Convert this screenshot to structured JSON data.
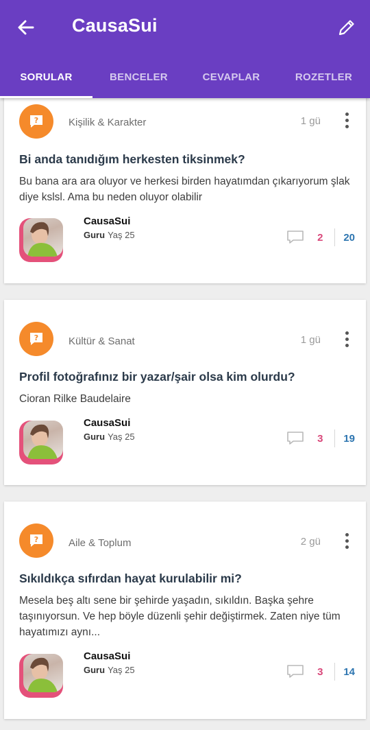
{
  "app": {
    "title": "CausaSui"
  },
  "tabs": [
    "SORULAR",
    "BENCELER",
    "CEVAPLAR",
    "ROZETLER"
  ],
  "posts": [
    {
      "category": "Kişilik & Karakter",
      "time": "1 gü",
      "title": "Bi anda tanıdığım herkesten tiksinmek?",
      "body": "Bu bana ara ara oluyor ve herkesi birden hayatımdan çıkarıyorum şlak diye kslsl. Ama bu neden oluyor olabilir",
      "author": "CausaSui",
      "rank": "Guru",
      "age": "Yaş 25",
      "comments": "2",
      "votes": "20"
    },
    {
      "category": "Kültür & Sanat",
      "time": "1 gü",
      "title": "Profil fotoğrafınız bir yazar/şair olsa kim olurdu?",
      "body": "Cioran Rilke Baudelaire",
      "author": "CausaSui",
      "rank": "Guru",
      "age": "Yaş 25",
      "comments": "3",
      "votes": "19"
    },
    {
      "category": "Aile & Toplum",
      "time": "2 gü",
      "title": "Sıkıldıkça sıfırdan hayat kurulabilir mi?",
      "body": "Mesela beş altı sene bir şehirde yaşadın, sıkıldın. Başka şehre taşınıyorsun. Ve hep böyle düzenli şehir değiştirmek. Zaten niye tüm hayatımızı aynı...",
      "author": "CausaSui",
      "rank": "Guru",
      "age": "Yaş 25",
      "comments": "3",
      "votes": "14"
    }
  ]
}
